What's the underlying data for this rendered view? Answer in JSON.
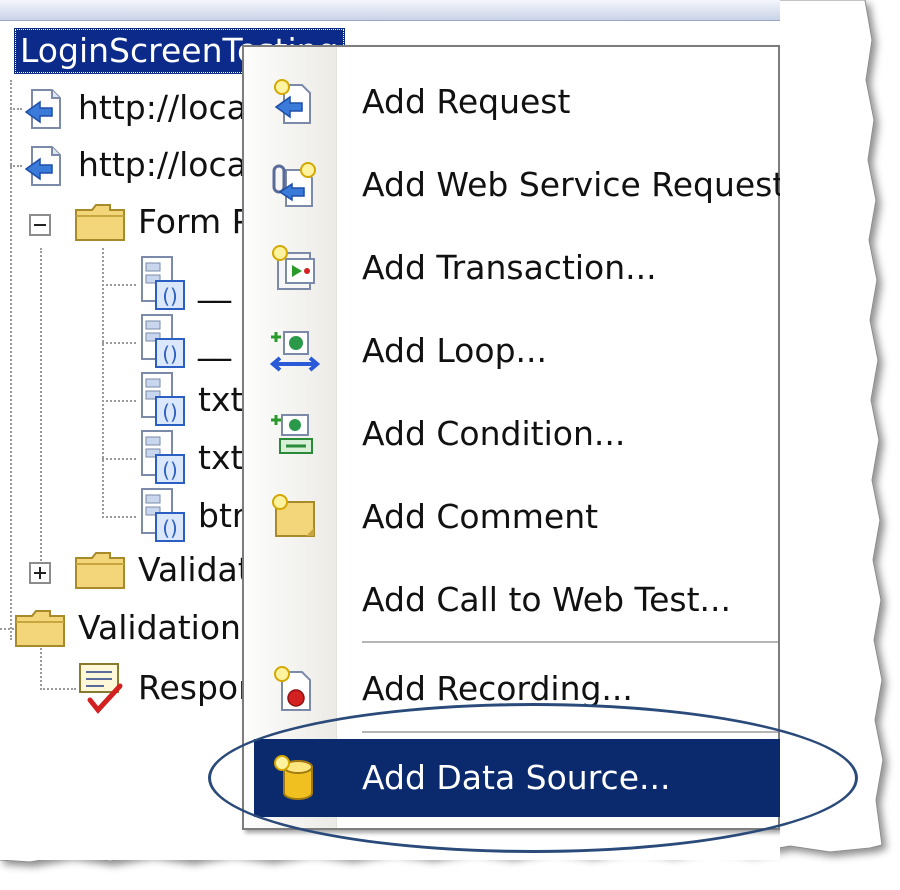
{
  "tree": {
    "root": "LoginScreenTesting",
    "request_1": "http://loca",
    "request_2": "http://loca",
    "form_post": "Form P",
    "params": [
      "__",
      "__",
      "txt",
      "txt",
      "btn"
    ],
    "validation_a": "Validat",
    "validation_rules": "Validation R",
    "response": "Respon"
  },
  "menu": {
    "items": [
      {
        "label": "Add Request",
        "icon": "add-request-icon"
      },
      {
        "label": "Add Web Service Request",
        "icon": "add-web-service-request-icon"
      },
      {
        "label": "Add Transaction...",
        "icon": "add-transaction-icon"
      },
      {
        "label": "Add Loop...",
        "icon": "add-loop-icon"
      },
      {
        "label": "Add Condition...",
        "icon": "add-condition-icon"
      },
      {
        "label": "Add Comment",
        "icon": "add-comment-icon"
      },
      {
        "label": "Add Call to Web Test...",
        "icon": ""
      },
      {
        "label": "Add Recording...",
        "icon": "add-recording-icon"
      },
      {
        "label": "Add Data Source...",
        "icon": "add-data-source-icon"
      }
    ],
    "highlighted_index": 8
  },
  "colors": {
    "selection": "#0b2a6e",
    "root_selection": "#0b2a8a",
    "ellipse": "#2a4a7a"
  }
}
